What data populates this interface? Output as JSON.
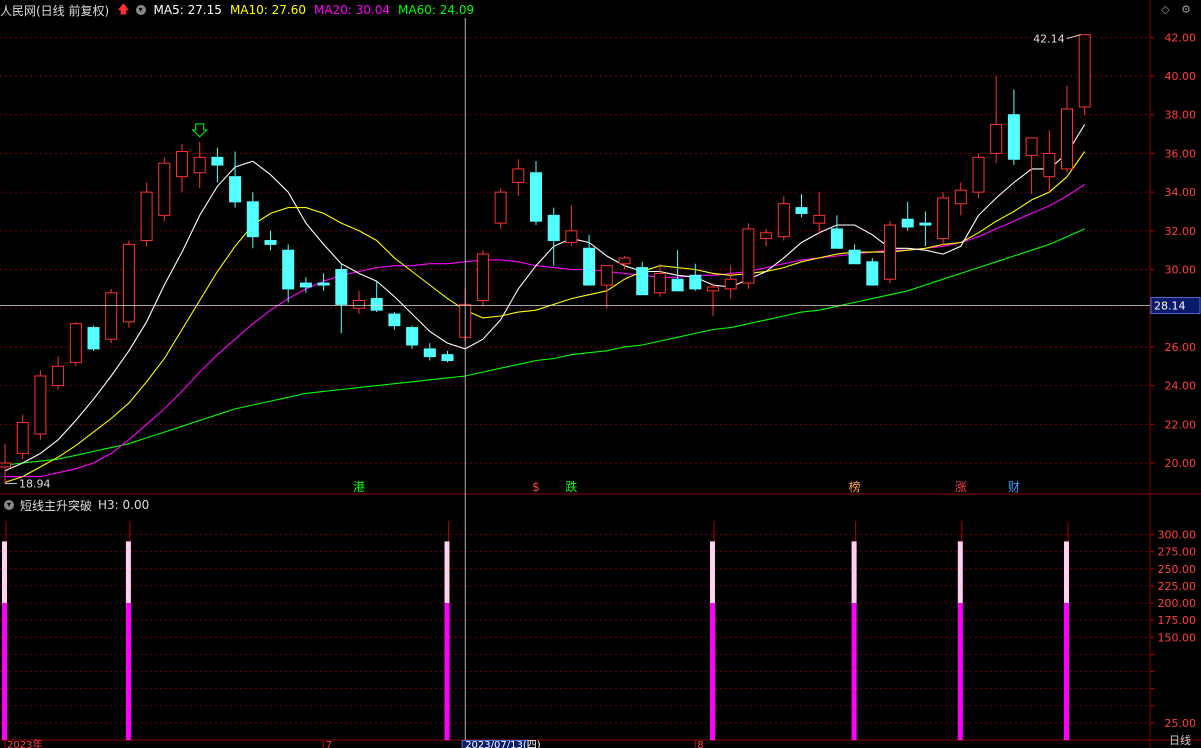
{
  "header": {
    "title": "人民网(日线 前复权)",
    "ma5": "MA5: 27.15",
    "ma10": "MA10: 27.60",
    "ma20": "MA20: 30.04",
    "ma60": "MA60: 24.09"
  },
  "indicator": {
    "name": "短线主升突破",
    "h3": "H3: 0.00"
  },
  "timeframe": "日线",
  "colors": {
    "up": "#ff3232",
    "down": "#54ffff",
    "ma5": "#ffffff",
    "ma10": "#ffff00",
    "ma20": "#ff00ff",
    "ma60": "#00ff00",
    "grid": "#8b0000",
    "signal": "#ff00ff"
  },
  "chart_data": [
    {
      "type": "candlestick",
      "y_axis_side": "right",
      "ylim": [
        18.4,
        43.0
      ],
      "y_ticks": [
        20.0,
        22.0,
        24.0,
        26.0,
        28.0,
        30.0,
        32.0,
        34.0,
        36.0,
        38.0,
        40.0,
        42.0
      ],
      "crosshair": {
        "x_date": "2023/07/13(四)",
        "y_value": 28.14,
        "y_label": "28.14"
      },
      "annotations": {
        "max_label": "42.14",
        "min_label": "18.94"
      },
      "candles": [
        [
          19.8,
          21.0,
          18.94,
          20.0
        ],
        [
          20.5,
          22.5,
          20.2,
          22.1
        ],
        [
          21.5,
          24.8,
          21.2,
          24.5
        ],
        [
          24.0,
          25.5,
          23.8,
          25.0
        ],
        [
          25.2,
          27.3,
          25.0,
          27.2
        ],
        [
          27.0,
          27.1,
          25.8,
          25.9
        ],
        [
          26.4,
          29.0,
          26.2,
          28.8
        ],
        [
          27.3,
          31.5,
          27.0,
          31.3
        ],
        [
          31.5,
          34.5,
          31.2,
          34.0
        ],
        [
          32.8,
          35.8,
          32.5,
          35.5
        ],
        [
          34.8,
          36.5,
          34.0,
          36.1
        ],
        [
          35.0,
          36.6,
          34.2,
          35.8
        ],
        [
          35.8,
          36.3,
          34.5,
          35.4
        ],
        [
          34.8,
          36.1,
          33.2,
          33.5
        ],
        [
          33.5,
          34.0,
          31.1,
          31.7
        ],
        [
          31.5,
          32.0,
          31.0,
          31.3
        ],
        [
          31.0,
          31.3,
          28.3,
          29.0
        ],
        [
          29.3,
          29.6,
          28.8,
          29.1
        ],
        [
          29.3,
          29.8,
          28.9,
          29.2
        ],
        [
          30.0,
          30.3,
          26.7,
          28.2
        ],
        [
          28.0,
          28.9,
          27.7,
          28.4
        ],
        [
          28.5,
          29.4,
          27.8,
          27.9
        ],
        [
          27.7,
          27.8,
          26.9,
          27.1
        ],
        [
          27.0,
          27.1,
          25.9,
          26.1
        ],
        [
          25.9,
          26.2,
          25.3,
          25.5
        ],
        [
          25.6,
          25.8,
          25.2,
          25.3
        ],
        [
          26.5,
          29.0,
          26.3,
          28.2
        ],
        [
          28.4,
          31.0,
          28.1,
          30.8
        ],
        [
          32.4,
          34.2,
          32.1,
          34.0
        ],
        [
          34.5,
          35.7,
          33.8,
          35.2
        ],
        [
          35.0,
          35.6,
          32.3,
          32.5
        ],
        [
          32.8,
          33.2,
          30.2,
          31.5
        ],
        [
          31.4,
          33.3,
          31.2,
          32.0
        ],
        [
          31.1,
          31.8,
          29.8,
          29.2
        ],
        [
          29.2,
          29.8,
          28.0,
          30.2
        ],
        [
          30.3,
          30.7,
          30.0,
          30.6
        ],
        [
          30.1,
          30.4,
          29.4,
          28.7
        ],
        [
          28.8,
          30.3,
          28.6,
          29.8
        ],
        [
          29.5,
          31.0,
          29.2,
          28.9
        ],
        [
          29.7,
          30.3,
          28.9,
          29.0
        ],
        [
          28.9,
          29.3,
          27.6,
          29.1
        ],
        [
          29.0,
          30.2,
          28.5,
          29.5
        ],
        [
          29.3,
          32.4,
          29.0,
          32.1
        ],
        [
          31.6,
          32.1,
          31.2,
          31.9
        ],
        [
          31.7,
          33.8,
          31.5,
          33.4
        ],
        [
          33.2,
          33.9,
          32.7,
          32.9
        ],
        [
          32.4,
          34.0,
          31.8,
          32.8
        ],
        [
          32.1,
          32.8,
          31.6,
          31.1
        ],
        [
          31.0,
          31.3,
          30.3,
          30.3
        ],
        [
          30.4,
          30.6,
          29.3,
          29.2
        ],
        [
          29.5,
          32.5,
          29.3,
          32.3
        ],
        [
          32.6,
          33.5,
          32.0,
          32.2
        ],
        [
          32.4,
          33.0,
          31.2,
          32.3
        ],
        [
          31.6,
          34.0,
          31.2,
          33.7
        ],
        [
          33.4,
          34.5,
          32.8,
          34.1
        ],
        [
          34.0,
          36.0,
          33.7,
          35.8
        ],
        [
          36.0,
          40.0,
          35.5,
          37.5
        ],
        [
          38.0,
          39.3,
          35.4,
          35.7
        ],
        [
          35.9,
          36.6,
          33.9,
          36.8
        ],
        [
          34.8,
          37.2,
          34.0,
          36.0
        ],
        [
          35.2,
          39.5,
          35.0,
          38.3
        ],
        [
          38.4,
          42.14,
          38.0,
          42.14
        ]
      ],
      "ma5": [
        19.6,
        20.0,
        20.5,
        21.2,
        22.2,
        23.3,
        24.5,
        25.8,
        27.3,
        29.2,
        30.9,
        32.8,
        34.3,
        35.3,
        35.6,
        34.9,
        34.0,
        32.4,
        31.3,
        30.3,
        29.8,
        29.4,
        28.6,
        27.7,
        26.8,
        26.2,
        25.9,
        26.4,
        27.4,
        29.0,
        30.2,
        31.2,
        31.6,
        31.4,
        30.7,
        30.2,
        29.9,
        29.9,
        29.7,
        29.6,
        29.2,
        29.1,
        29.5,
        29.9,
        30.6,
        31.4,
        31.9,
        32.3,
        32.3,
        31.8,
        31.1,
        31.1,
        31.0,
        30.8,
        31.2,
        32.8,
        33.7,
        34.5,
        35.2,
        35.2,
        36.0,
        37.5
      ],
      "ma10": [
        19.0,
        19.3,
        19.8,
        20.3,
        20.9,
        21.6,
        22.3,
        23.1,
        24.2,
        25.4,
        26.9,
        28.4,
        29.9,
        31.2,
        32.3,
        32.9,
        33.2,
        33.2,
        32.9,
        32.4,
        32.0,
        31.5,
        30.6,
        29.9,
        29.2,
        28.5,
        27.9,
        27.5,
        27.6,
        27.8,
        27.9,
        28.2,
        28.5,
        28.7,
        28.9,
        29.5,
        29.9,
        30.2,
        30.1,
        30.0,
        29.8,
        29.7,
        29.8,
        29.9,
        30.1,
        30.4,
        30.6,
        30.8,
        30.9,
        30.9,
        30.9,
        31.0,
        31.1,
        31.3,
        31.4,
        31.9,
        32.5,
        33.0,
        33.6,
        34.0,
        34.8,
        36.1
      ],
      "ma20": [
        19.3,
        19.3,
        19.3,
        19.5,
        19.7,
        20.0,
        20.5,
        21.2,
        22.0,
        22.8,
        23.7,
        24.7,
        25.6,
        26.4,
        27.2,
        27.9,
        28.5,
        29.0,
        29.4,
        29.7,
        29.9,
        30.1,
        30.2,
        30.2,
        30.3,
        30.3,
        30.4,
        30.5,
        30.5,
        30.4,
        30.2,
        30.1,
        30.0,
        30.0,
        29.9,
        29.8,
        29.7,
        29.6,
        29.6,
        29.7,
        29.7,
        29.8,
        29.9,
        30.1,
        30.3,
        30.5,
        30.6,
        30.7,
        30.8,
        30.9,
        31.0,
        31.0,
        31.1,
        31.2,
        31.4,
        31.7,
        32.1,
        32.5,
        32.9,
        33.3,
        33.8,
        34.4
      ],
      "ma60": [
        19.9,
        20.0,
        20.1,
        20.2,
        20.4,
        20.6,
        20.8,
        21.0,
        21.3,
        21.6,
        21.9,
        22.2,
        22.5,
        22.8,
        23.0,
        23.2,
        23.4,
        23.6,
        23.7,
        23.8,
        23.9,
        24.0,
        24.1,
        24.2,
        24.3,
        24.4,
        24.5,
        24.7,
        24.9,
        25.1,
        25.3,
        25.4,
        25.6,
        25.7,
        25.8,
        26.0,
        26.1,
        26.3,
        26.5,
        26.7,
        26.9,
        27.0,
        27.2,
        27.4,
        27.6,
        27.8,
        27.9,
        28.1,
        28.3,
        28.5,
        28.7,
        28.9,
        29.2,
        29.5,
        29.8,
        30.1,
        30.4,
        30.7,
        31.0,
        31.3,
        31.7,
        32.1
      ],
      "event_markers": [
        {
          "index": 20,
          "text": "港",
          "color": "#00ff00"
        },
        {
          "index": 30,
          "text": "$",
          "color": "#ff4040"
        },
        {
          "index": 32,
          "text": "跌",
          "color": "#00ff00"
        },
        {
          "index": 48,
          "text": "榜",
          "color": "#ffa040"
        },
        {
          "index": 54,
          "text": "涨",
          "color": "#ff4040"
        },
        {
          "index": 57,
          "text": "财",
          "color": "#40a0ff"
        }
      ]
    },
    {
      "type": "bar",
      "title": "短线主升突破",
      "ylim": [
        0,
        330
      ],
      "y_ticks": [
        25,
        50,
        75,
        100,
        125,
        150,
        175,
        200,
        225,
        250,
        275,
        300
      ],
      "y_tick_labels": [
        "25.00",
        "",
        "",
        "",
        "",
        "150.00",
        "175.00",
        "200.00",
        "225.00",
        "250.00",
        "275.00",
        "300.00"
      ],
      "signals": [
        {
          "index": 0,
          "tall": 290,
          "base": 200
        },
        {
          "index": 7,
          "tall": 290,
          "base": 200
        },
        {
          "index": 25,
          "tall": 290,
          "base": 200
        },
        {
          "index": 40,
          "tall": 290,
          "base": 200
        },
        {
          "index": 48,
          "tall": 290,
          "base": 200
        },
        {
          "index": 54,
          "tall": 290,
          "base": 200
        },
        {
          "index": 60,
          "tall": 290,
          "base": 200
        }
      ],
      "x_labels": [
        {
          "index": 0,
          "text": "2023年"
        },
        {
          "index": 18,
          "text": "7"
        },
        {
          "index": 26,
          "text": "2023/07/13(四)"
        },
        {
          "index": 39,
          "text": "8"
        }
      ]
    }
  ]
}
